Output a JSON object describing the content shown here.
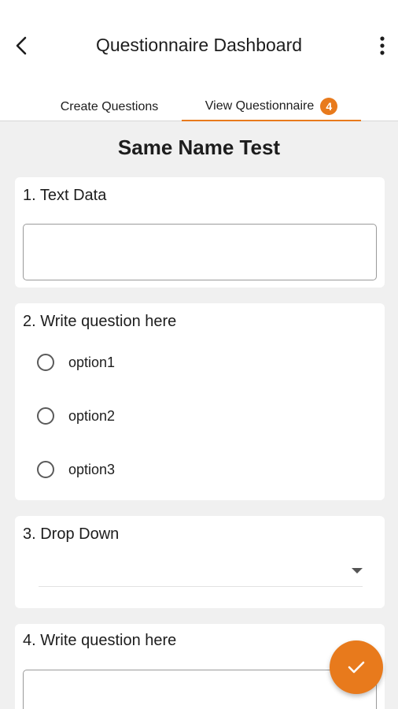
{
  "header": {
    "title": "Questionnaire Dashboard",
    "back_icon": "arrow-back-icon",
    "menu_icon": "more-vert-icon"
  },
  "tabs": [
    {
      "label": "Create Questions",
      "active": false
    },
    {
      "label": "View Questionnaire",
      "active": true,
      "badge": "4"
    }
  ],
  "questionnaire": {
    "name": "Same Name Test",
    "questions": [
      {
        "label": "1. Text Data",
        "type": "text",
        "value": ""
      },
      {
        "label": "2. Write question here",
        "type": "radio",
        "options": [
          "option1",
          "option2",
          "option3"
        ]
      },
      {
        "label": "3. Drop Down",
        "type": "dropdown",
        "selected": ""
      },
      {
        "label": "4. Write question here",
        "type": "text",
        "value": ""
      }
    ]
  },
  "fab": {
    "icon": "check-icon"
  },
  "colors": {
    "accent": "#e87a1c",
    "background": "#f0f0f0",
    "card": "#ffffff"
  }
}
